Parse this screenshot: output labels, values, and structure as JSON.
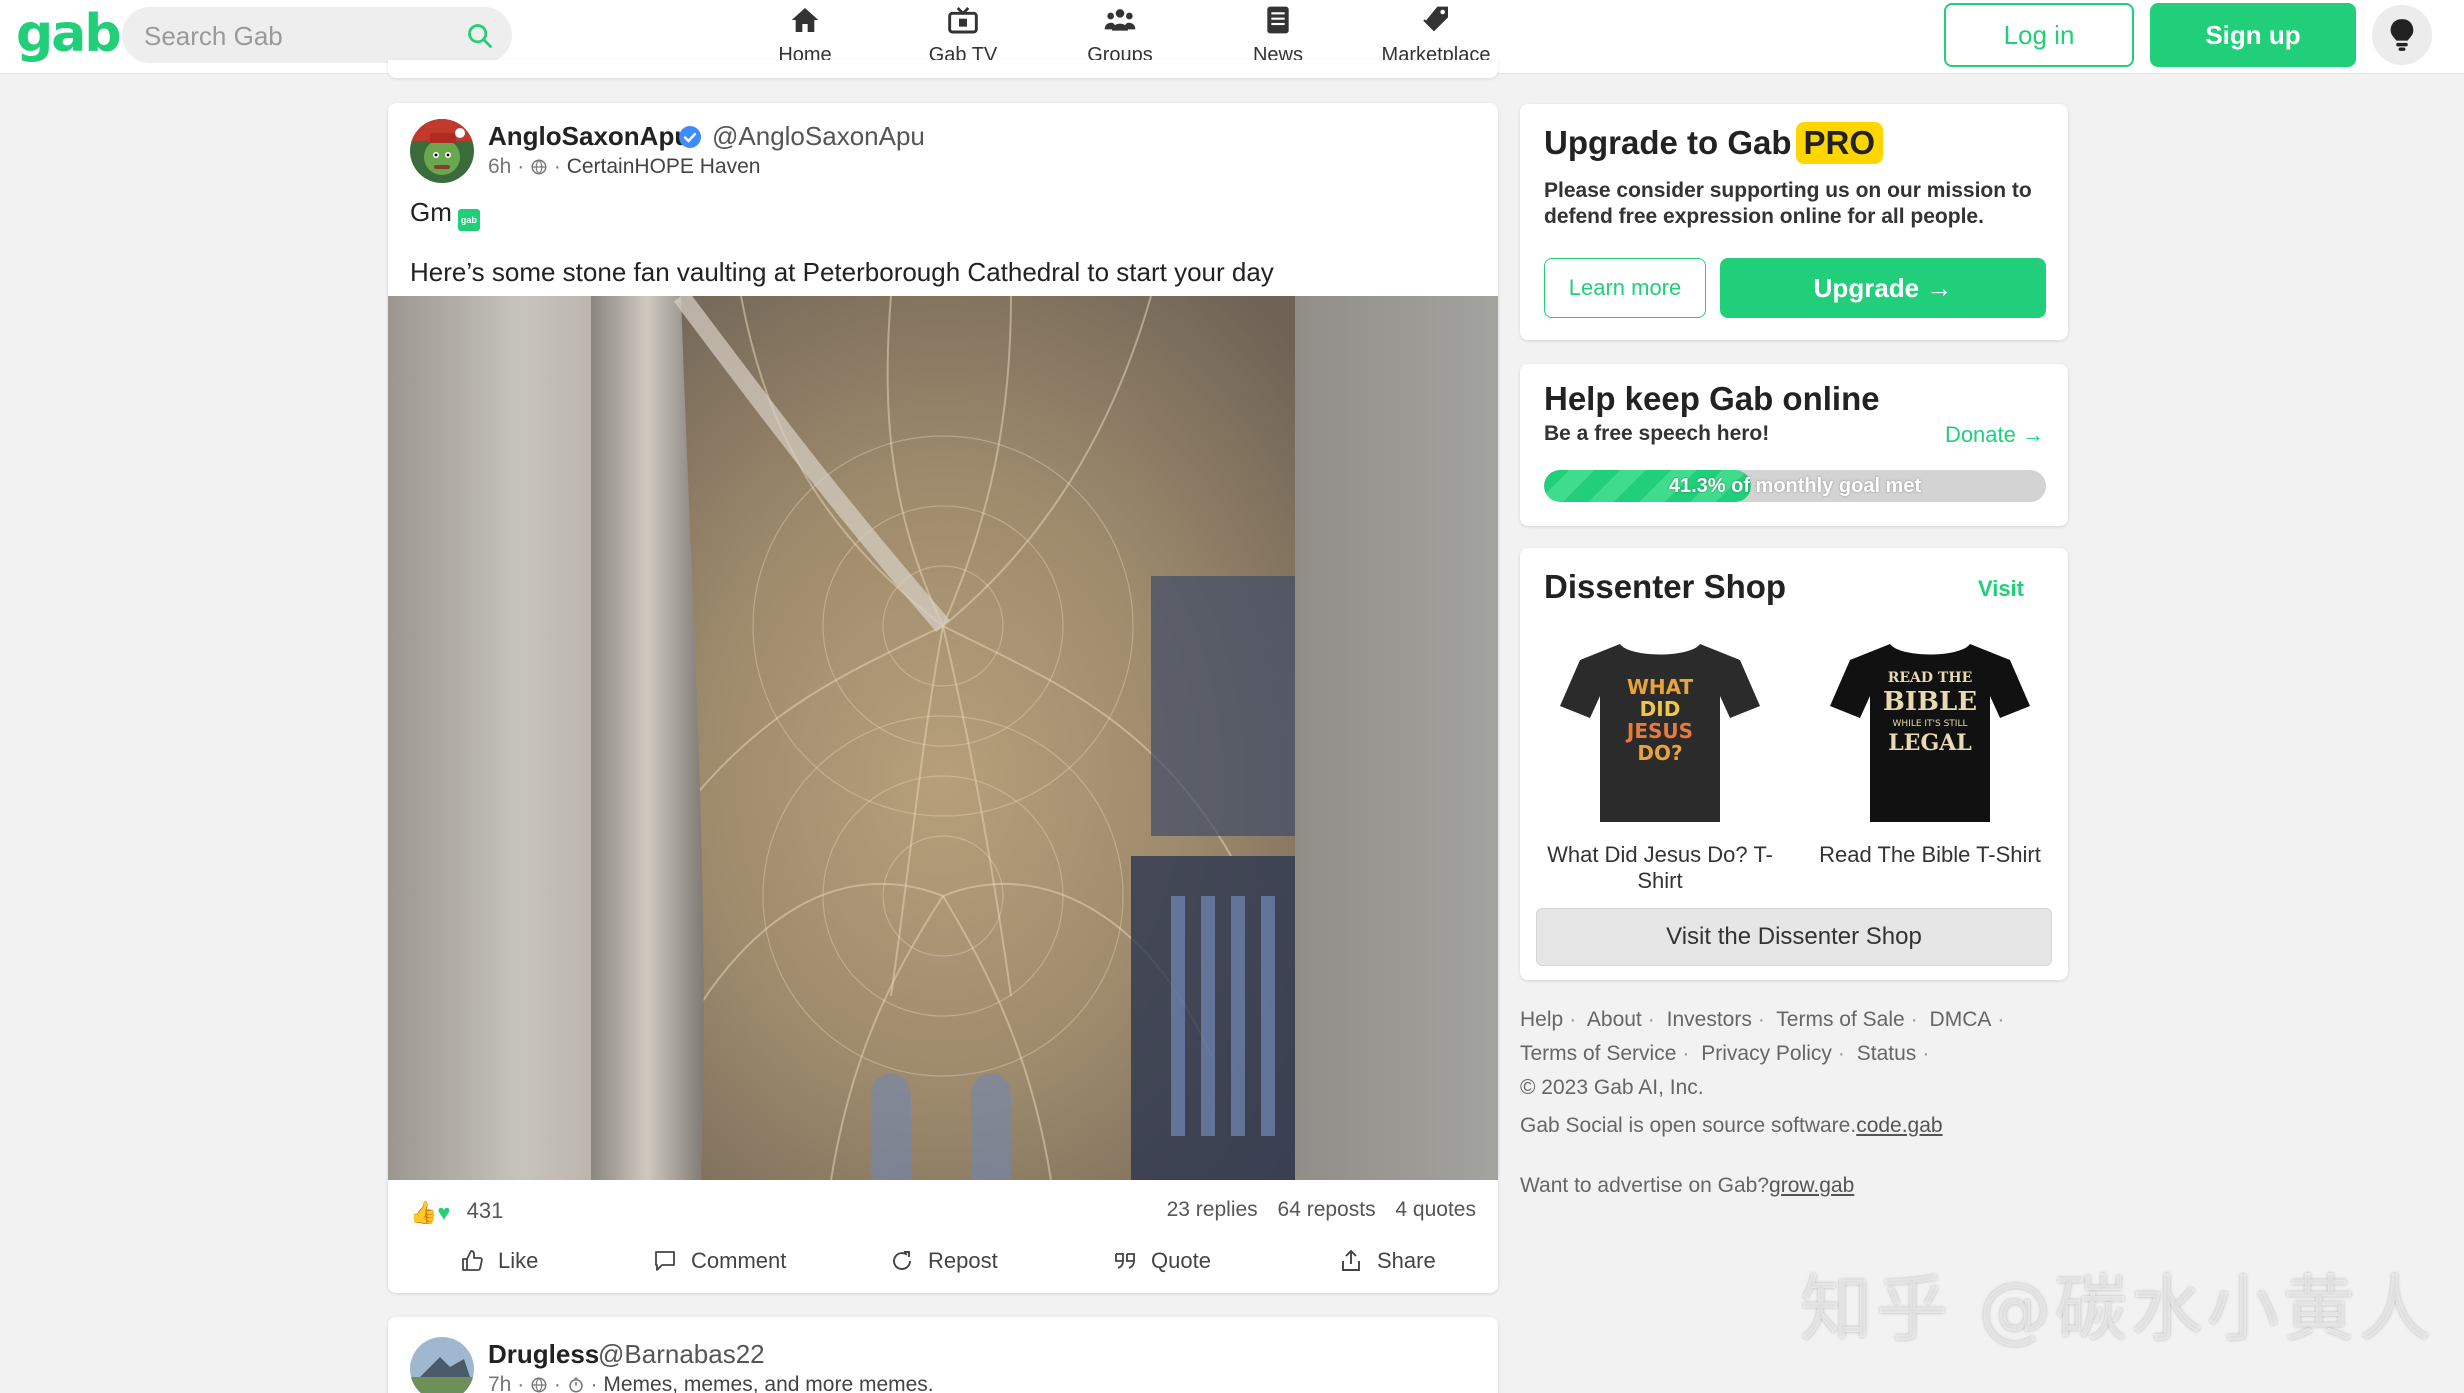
{
  "header": {
    "logo": "gab",
    "search_placeholder": "Search Gab",
    "nav": [
      {
        "label": "Home",
        "icon": "home-icon"
      },
      {
        "label": "Gab TV",
        "icon": "tv-icon"
      },
      {
        "label": "Groups",
        "icon": "groups-icon"
      },
      {
        "label": "News",
        "icon": "news-icon"
      },
      {
        "label": "Marketplace",
        "icon": "tag-icon"
      }
    ],
    "login_label": "Log in",
    "signup_label": "Sign up",
    "theme_icon": "lightbulb-icon"
  },
  "post": {
    "author_name": "AngloSaxonApu",
    "author_handle": "@AngloSaxonApu",
    "verified": true,
    "time": "6h",
    "group": "CertainHOPE Haven",
    "text_line_1": "Gm",
    "emoji_label": "gab",
    "text_line_2": "Here’s some stone fan vaulting at Peterborough Cathedral to start your day",
    "reaction_count": "431",
    "replies": "23 replies",
    "reposts": "64 reposts",
    "quotes": "4 quotes",
    "actions": {
      "like": "Like",
      "comment": "Comment",
      "repost": "Repost",
      "quote": "Quote",
      "share": "Share"
    }
  },
  "post2": {
    "author_name": "Drugless",
    "author_handle": "@Barnabas22",
    "time": "7h",
    "group": "Memes, memes, and more memes."
  },
  "sidebar": {
    "pro": {
      "title": "Upgrade to Gab",
      "badge": "PRO",
      "description": "Please consider supporting us on our mission to defend free expression online for all people.",
      "learn_more": "Learn more",
      "upgrade": "Upgrade →"
    },
    "donate": {
      "title": "Help keep Gab online",
      "subtitle": "Be a free speech hero!",
      "link": "Donate →",
      "progress_label": "41.3% of monthly goal met",
      "progress_fraction": 0.413
    },
    "shop": {
      "title": "Dissenter Shop",
      "visit": "Visit",
      "items": [
        {
          "label": "What Did Jesus Do? T-Shirt",
          "print": [
            "WHAT",
            "DID",
            "JESUS",
            "DO?"
          ]
        },
        {
          "label": "Read The Bible T-Shirt",
          "print": [
            "READ THE",
            "BIBLE",
            "WHILE IT'S STILL",
            "LEGAL"
          ]
        }
      ],
      "visit_button": "Visit the Dissenter Shop"
    },
    "footer": {
      "links_row1": [
        "Help",
        "About",
        "Investors",
        "Terms of Sale",
        "DMCA"
      ],
      "links_row2": [
        "Terms of Service",
        "Privacy Policy",
        "Status"
      ],
      "copyright": "© 2023 Gab AI, Inc.",
      "oss_text": "Gab Social is open source software.",
      "oss_link": "code.gab",
      "ad_text": "Want to advertise on Gab?",
      "ad_link": "grow.gab"
    }
  },
  "watermark": "知乎 @碳水小黄人",
  "colors": {
    "brand": "#21cf7a",
    "pro_badge": "#ffd600"
  }
}
